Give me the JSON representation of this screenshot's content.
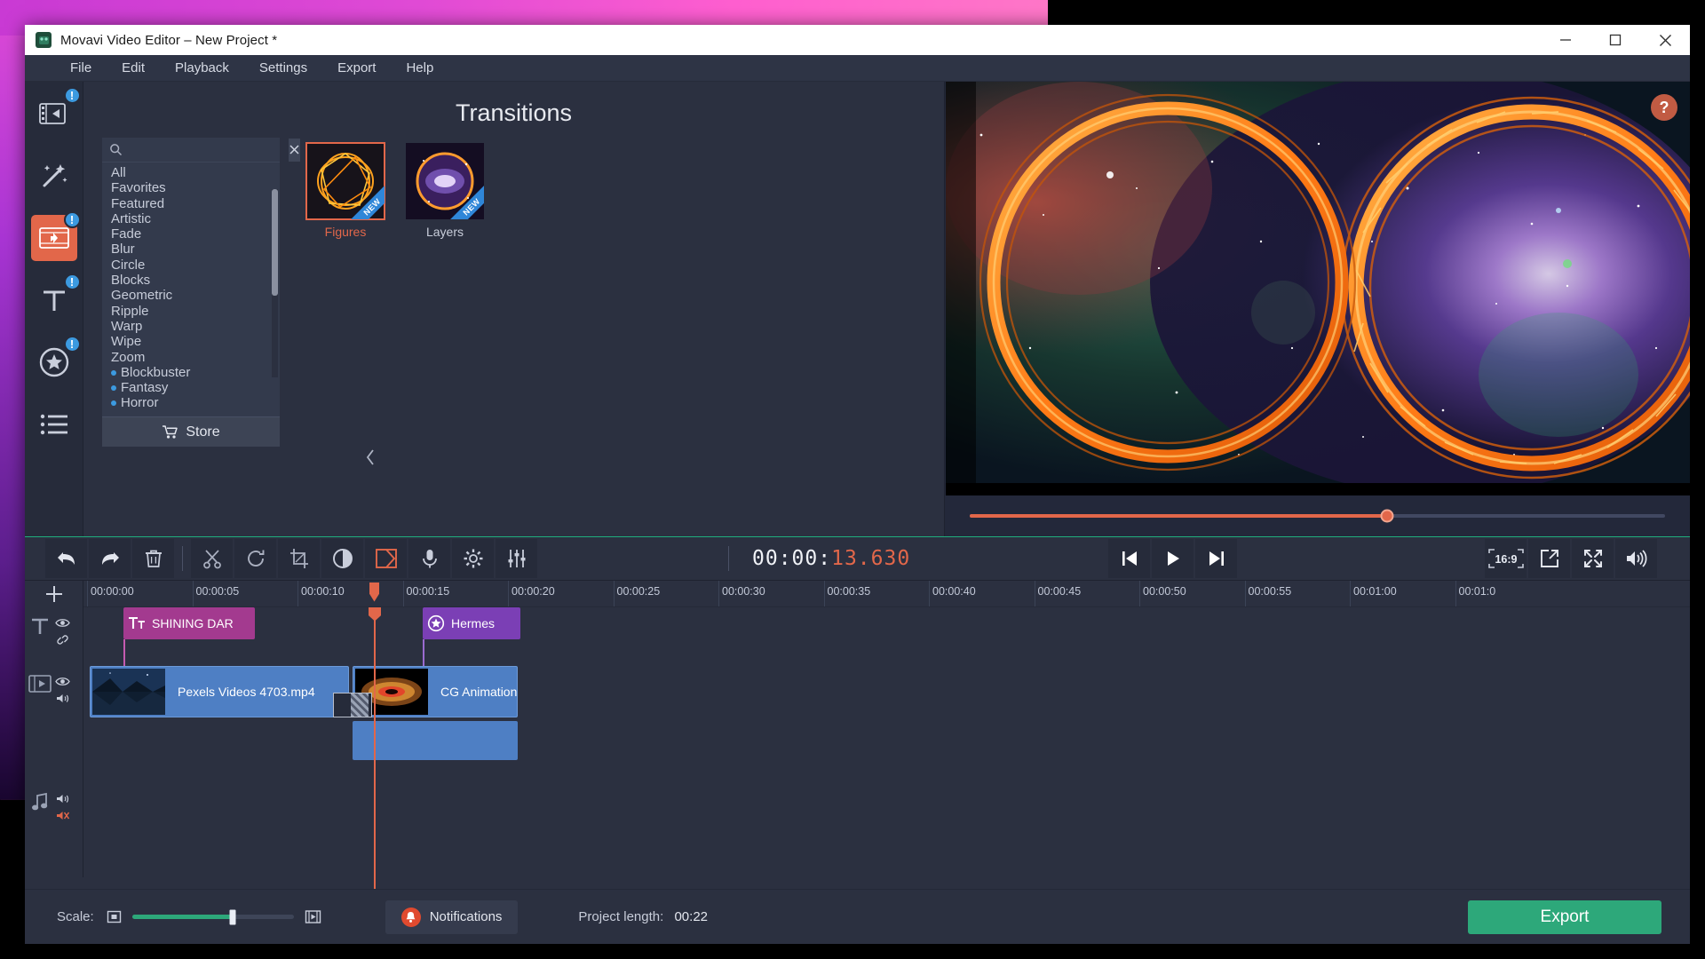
{
  "window": {
    "title": "Movavi Video Editor – New Project *",
    "app_icon": "movavi-logo-icon",
    "minimize": "minimize-icon",
    "maximize": "maximize-icon",
    "close": "close-icon"
  },
  "menubar": {
    "items": [
      "File",
      "Edit",
      "Playback",
      "Settings",
      "Export",
      "Help"
    ]
  },
  "rail": {
    "items": [
      {
        "name": "import",
        "icon": "import-media-icon",
        "badge": "!",
        "active": false
      },
      {
        "name": "filters",
        "icon": "magic-wand-icon",
        "badge": "",
        "active": false
      },
      {
        "name": "transitions",
        "icon": "transitions-film-icon",
        "badge": "!",
        "active": true
      },
      {
        "name": "titles",
        "icon": "titles-text-icon",
        "badge": "!",
        "active": false
      },
      {
        "name": "stickers",
        "icon": "stickers-star-icon",
        "badge": "!",
        "active": false
      },
      {
        "name": "more-tools",
        "icon": "list-menu-icon",
        "badge": "",
        "active": false
      }
    ]
  },
  "browser": {
    "title": "Transitions",
    "search": {
      "value": "",
      "placeholder": "",
      "icon": "search-icon",
      "clear_icon": "clear-x-icon"
    },
    "categories": [
      {
        "label": "All",
        "bullet": false
      },
      {
        "label": "Favorites",
        "bullet": false
      },
      {
        "label": "Featured",
        "bullet": false
      },
      {
        "label": "Artistic",
        "bullet": false
      },
      {
        "label": "Fade",
        "bullet": false
      },
      {
        "label": "Blur",
        "bullet": false
      },
      {
        "label": "Circle",
        "bullet": false
      },
      {
        "label": "Blocks",
        "bullet": false
      },
      {
        "label": "Geometric",
        "bullet": false
      },
      {
        "label": "Ripple",
        "bullet": false
      },
      {
        "label": "Warp",
        "bullet": false
      },
      {
        "label": "Wipe",
        "bullet": false
      },
      {
        "label": "Zoom",
        "bullet": false
      },
      {
        "label": "Blockbuster",
        "bullet": true
      },
      {
        "label": "Fantasy",
        "bullet": true
      },
      {
        "label": "Horror",
        "bullet": true
      }
    ],
    "store_label": "Store",
    "store_icon": "store-cart-icon",
    "collapse_icon": "chevron-left-icon",
    "tiles": [
      {
        "label": "Figures",
        "badge": "NEW",
        "selected": true,
        "thumb": "orange-wireframe-sphere"
      },
      {
        "label": "Layers",
        "badge": "NEW",
        "selected": false,
        "thumb": "purple-galaxy-ring"
      }
    ]
  },
  "preview": {
    "help_label": "?",
    "seek": {
      "progress_pct": 60
    },
    "timecode": {
      "head": "00:00:",
      "frac": "13.630"
    },
    "transport": [
      {
        "name": "previous-frame",
        "icon": "skip-previous-icon"
      },
      {
        "name": "play",
        "icon": "play-icon"
      },
      {
        "name": "next-frame",
        "icon": "skip-next-icon"
      }
    ],
    "right_tools": [
      {
        "name": "aspect-ratio",
        "label": "16:9",
        "icon": "aspect-ratio-icon"
      },
      {
        "name": "snapshot",
        "label": "",
        "icon": "export-frame-icon"
      },
      {
        "name": "fullscreen",
        "label": "",
        "icon": "fullscreen-icon"
      },
      {
        "name": "volume",
        "label": "",
        "icon": "speaker-icon"
      }
    ]
  },
  "toolbar": {
    "tools": [
      {
        "name": "undo",
        "icon": "undo-arrow-icon"
      },
      {
        "name": "redo",
        "icon": "redo-arrow-icon"
      },
      {
        "name": "delete",
        "icon": "trash-icon"
      },
      {
        "name": "split",
        "icon": "scissors-icon"
      },
      {
        "name": "rotate",
        "icon": "rotate-icon"
      },
      {
        "name": "crop",
        "icon": "crop-icon"
      },
      {
        "name": "color-adjust",
        "icon": "contrast-circle-icon"
      },
      {
        "name": "transition-tool",
        "icon": "transition-bracket-icon"
      },
      {
        "name": "record-audio",
        "icon": "microphone-icon"
      },
      {
        "name": "clip-properties",
        "icon": "gear-icon"
      },
      {
        "name": "equalizer",
        "icon": "sliders-icon"
      }
    ]
  },
  "timeline": {
    "add_track_icon": "plus-icon",
    "ruler_labels": [
      "00:00:00",
      "00:00:05",
      "00:00:10",
      "00:00:15",
      "00:00:20",
      "00:00:25",
      "00:00:30",
      "00:00:35",
      "00:00:40",
      "00:00:45",
      "00:00:50",
      "00:00:55",
      "00:01:00",
      "00:01:0"
    ],
    "playhead_time": "00:00:13.630",
    "tracks": [
      {
        "name": "titles-track",
        "head_icon": "titles-text-icon",
        "toggles": [
          "eye-icon",
          "link-icon"
        ],
        "clips": [
          {
            "label": "SHINING DAR",
            "icon": "title-Tt-icon",
            "kind": "title"
          },
          {
            "label": "Hermes",
            "icon": "sticker-star-icon",
            "kind": "sticker"
          }
        ]
      },
      {
        "name": "video-track",
        "head_icon": "video-film-icon",
        "toggles": [
          "eye-icon",
          "speaker-icon"
        ],
        "clips": [
          {
            "label": "Pexels Videos 4703.mp4",
            "kind": "video",
            "thumb": "night-lake-mountains"
          },
          {
            "label": "CG Animation",
            "kind": "video",
            "thumb": "black-hole-accretion"
          }
        ],
        "transition": {
          "icon": "transition-hatch-icon"
        }
      },
      {
        "name": "audio-track",
        "head_icon": "music-note-icon",
        "toggles": [
          "speaker-icon",
          "mute-icon"
        ],
        "clips": []
      }
    ]
  },
  "statusbar": {
    "scale_label": "Scale:",
    "scale_min_icon": "zoom-out-frame-icon",
    "scale_max_icon": "zoom-in-frame-icon",
    "scale_pct": 62,
    "notifications_label": "Notifications",
    "notifications_icon": "bell-icon",
    "project_length_label": "Project length:",
    "project_length_value": "00:22",
    "export_label": "Export"
  },
  "colors": {
    "accent_orange": "#e2674a",
    "accent_green": "#2da87a",
    "badge_blue": "#3c9ae0",
    "title_clip": "#a33a8f",
    "sticker_clip": "#7b3fb5",
    "video_clip": "#4e7fc4",
    "panel_bg": "#2b3040"
  }
}
